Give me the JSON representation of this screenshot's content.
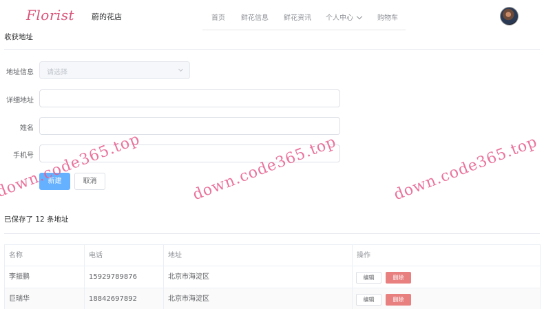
{
  "header": {
    "logo_text": "Florist",
    "shop_name": "蔚的花店",
    "nav": [
      {
        "label": "首页"
      },
      {
        "label": "鲜花信息"
      },
      {
        "label": "鲜花资讯"
      },
      {
        "label": "个人中心"
      },
      {
        "label": "购物车"
      }
    ]
  },
  "address_form": {
    "title": "收获地址",
    "region_label": "地址信息",
    "region_placeholder": "请选择",
    "detail_label": "详细地址",
    "detail_value": "",
    "name_label": "姓名",
    "name_value": "",
    "phone_label": "手机号",
    "phone_value": "",
    "submit_label": "新建",
    "cancel_label": "取消"
  },
  "saved": {
    "title": "已保存了 12 条地址",
    "columns": [
      "名称",
      "电话",
      "地址",
      "操作"
    ],
    "rows": [
      {
        "name": "李振鹏",
        "phone": "15929789876",
        "address": "北京市海淀区",
        "edit": "编辑",
        "delete": "删除"
      },
      {
        "name": "巨瑞华",
        "phone": "18842697892",
        "address": "北京市海淀区",
        "edit": "编辑",
        "delete": "删除"
      }
    ]
  },
  "watermark": "down.code365.top",
  "colors": {
    "primary": "#66b1ff",
    "danger": "#e88080",
    "watermark": "#e65a8c",
    "logo": "#d9547a"
  }
}
